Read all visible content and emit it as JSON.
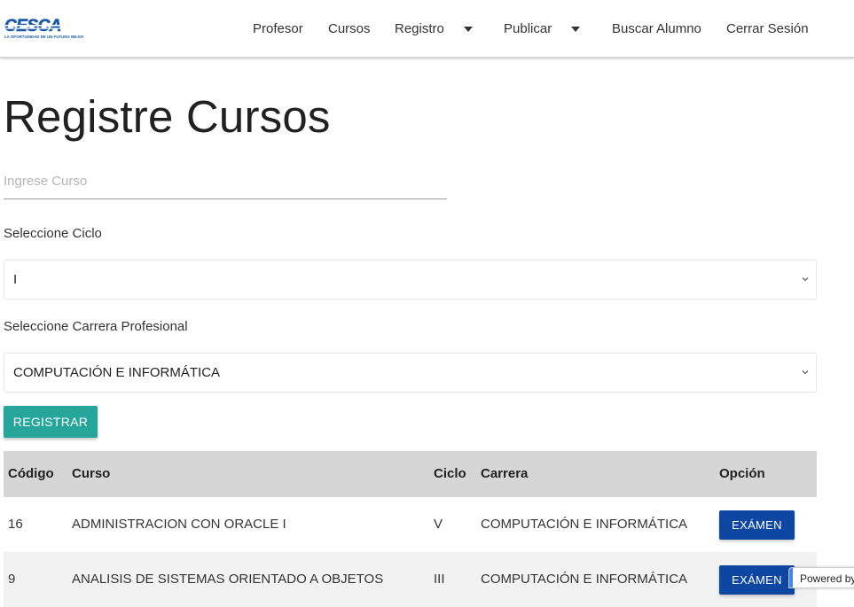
{
  "header": {
    "logo_text": "CESCA",
    "logo_tagline": "LA OPORTUNIDAD DE UN FUTURO MEJOR",
    "nav": [
      {
        "label": "Profesor"
      },
      {
        "label": "Cursos"
      },
      {
        "label": "Registro",
        "dropdown": true
      },
      {
        "label": "Publicar",
        "dropdown": true
      },
      {
        "label": "Buscar Alumno"
      },
      {
        "label": "Cerrar Sesión"
      }
    ]
  },
  "page": {
    "title": "Registre Cursos"
  },
  "form": {
    "course_placeholder": "Ingrese Curso",
    "course_value": "",
    "cycle_label": "Seleccione Ciclo",
    "cycle_selected": "I",
    "career_label": "Seleccione Carrera Profesional",
    "career_selected": "COMPUTACIÓN E INFORMÁTICA",
    "register_label": "REGISTRAR"
  },
  "table": {
    "headers": [
      "Código",
      "Curso",
      "Ciclo",
      "Carrera",
      "Opción"
    ],
    "rows": [
      {
        "codigo": "16",
        "curso": "ADMINISTRACION CON ORACLE I",
        "ciclo": "V",
        "carrera": "COMPUTACIÓN E INFORMÁTICA",
        "opcion": "EXÁMEN"
      },
      {
        "codigo": "9",
        "curso": "ANALISIS DE SISTEMAS ORIENTADO A OBJETOS",
        "ciclo": "III",
        "carrera": "COMPUTACIÓN E INFORMÁTICA",
        "opcion": "EXÁMEN"
      }
    ]
  },
  "widget": {
    "powered_label": "Powered by"
  },
  "colors": {
    "accent_teal": "#26a69a",
    "exam_blue": "#0d47a1",
    "logo_blue": "#1a5aa8",
    "header_row": "#d6d6d6"
  }
}
